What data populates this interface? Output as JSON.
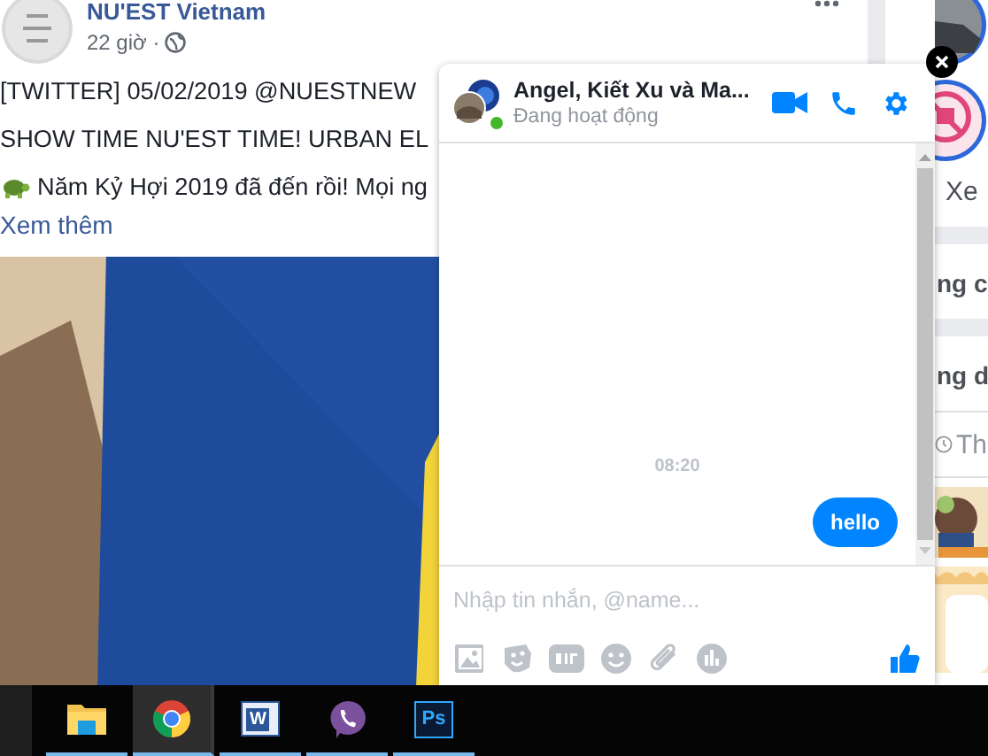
{
  "post": {
    "page_name": "NU'EST Vietnam",
    "time": "22 giờ ·",
    "lines": [
      {
        "text": "[TWITTER] 05/02/2019 @NUESTNEW",
        "emoji": false
      },
      {
        "text": "SHOW TIME NU'EST TIME! URBAN EL",
        "emoji": false
      },
      {
        "text": "Năm Kỷ Hợi 2019 đã đến rồi! Mọi ng",
        "emoji": true
      }
    ],
    "see_more": "Xem thêm"
  },
  "sidebar": {
    "see_more": "Xe",
    "headings": [
      "ng c",
      "ng d"
    ],
    "item": "Th"
  },
  "chat": {
    "title": "Angel, Kiết Xu và Ma...",
    "status": "Đang hoạt động",
    "online": true,
    "time": "08:20",
    "messages": [
      {
        "text": "hello",
        "outgoing": true
      }
    ],
    "input": {
      "placeholder": "Nhập tin nhắn, @name..."
    }
  },
  "taskbar": {
    "apps": [
      {
        "kind": "folder",
        "selected": false
      },
      {
        "kind": "chrome",
        "selected": true
      },
      {
        "kind": "word",
        "label": "W",
        "selected": false
      },
      {
        "kind": "viber",
        "selected": false
      },
      {
        "kind": "photoshop",
        "label": "Ps",
        "selected": false
      }
    ]
  }
}
